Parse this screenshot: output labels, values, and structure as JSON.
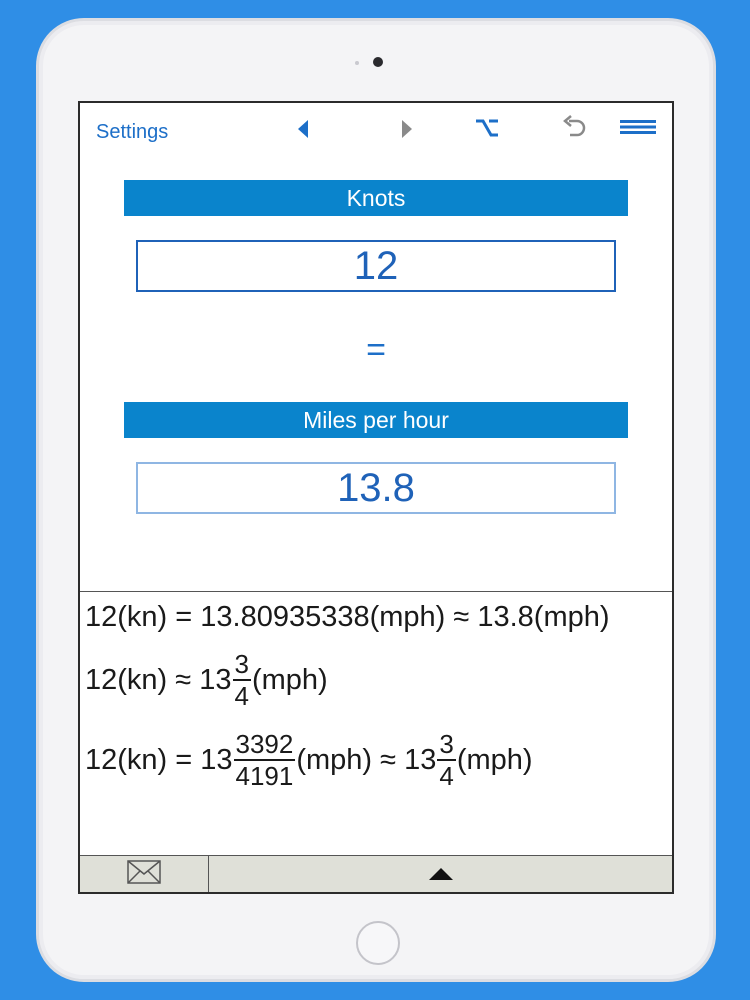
{
  "toolbar": {
    "settings_label": "Settings",
    "icons": [
      "back-icon",
      "forward-icon",
      "option-key-icon",
      "undo-icon",
      "menu-icon"
    ]
  },
  "converter": {
    "from_unit": "Knots",
    "from_value": "12",
    "equals": "=",
    "to_unit": "Miles per hour",
    "to_value": "13.8"
  },
  "results": {
    "line1": "12(kn) = 13.80935338(mph) ≈ 13.8(mph)",
    "line2": {
      "prefix": "12(kn) ≈ 13",
      "num": "3",
      "den": "4",
      "suffix": "(mph)"
    },
    "line3": {
      "prefix": "12(kn) = 13",
      "num1": "3392",
      "den1": "4191",
      "middle": "(mph) ≈ 13",
      "num2": "3",
      "den2": "4",
      "suffix": "(mph)"
    }
  },
  "bottom_bar": {
    "icons": [
      "mail-icon",
      "expand-up-icon"
    ]
  },
  "colors": {
    "background": "#2f8ee6",
    "accent": "#0a84cc",
    "link": "#1d6fc8"
  }
}
